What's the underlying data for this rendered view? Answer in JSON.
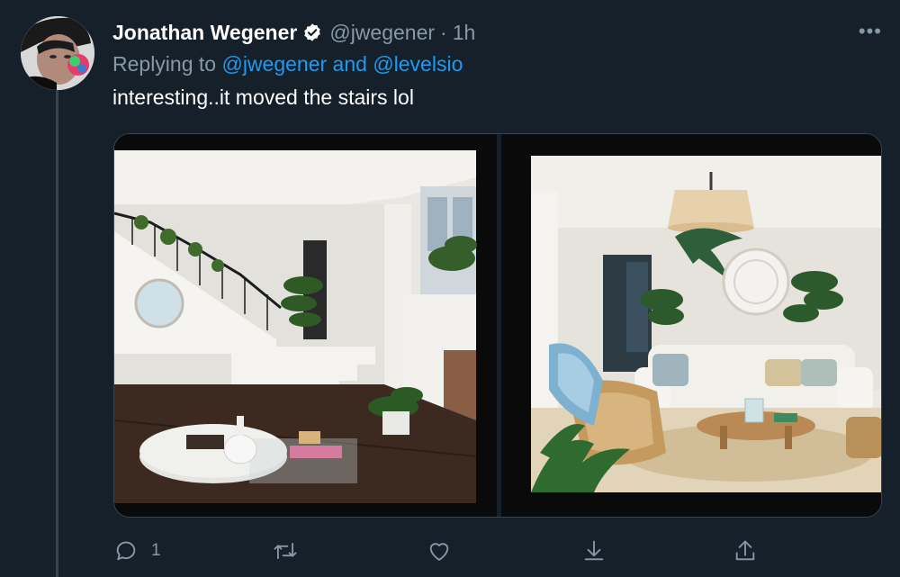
{
  "tweet": {
    "author_name": "Jonathan Wegener",
    "handle": "@jwegener",
    "separator": "·",
    "time": "1h",
    "more_label": "•••",
    "replying_prefix": "Replying to",
    "mention_1": "@jwegener",
    "mention_joiner": "and",
    "mention_2": "@levelsio",
    "text": "interesting..it moved the stairs lol"
  },
  "actions": {
    "reply_count": "1"
  },
  "icons": {
    "verified": "verified-badge-icon",
    "reply": "reply-icon",
    "retweet": "retweet-icon",
    "like": "heart-icon",
    "download": "download-icon",
    "share": "share-icon",
    "more": "more-icon"
  },
  "colors": {
    "background": "#15202b",
    "accent": "#1d9bf0",
    "secondary_text": "#8899a6",
    "border": "#38444d"
  }
}
